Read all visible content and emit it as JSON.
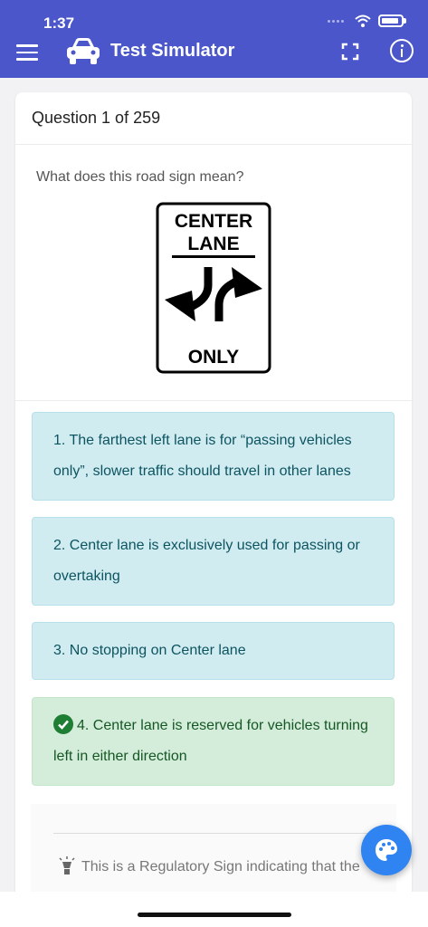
{
  "status_bar": {
    "time": "1:37"
  },
  "app_bar": {
    "title": "Test Simulator"
  },
  "question": {
    "counter": "Question 1 of 259",
    "text": "What does this road sign mean?",
    "sign": {
      "line1": "CENTER",
      "line2": "LANE",
      "line3": "ONLY"
    }
  },
  "answers": [
    {
      "label": "1. The farthest left lane is for “passing vehicles only”, slower traffic should travel in other lanes",
      "state": "info"
    },
    {
      "label": "2. Center lane is exclusively used for passing or overtaking",
      "state": "info"
    },
    {
      "label": "3. No stopping on Center lane",
      "state": "info"
    },
    {
      "label": "4. Center lane is reserved for vehicles turning left in either direction",
      "state": "correct"
    }
  ],
  "explanation": "This is a Regulatory Sign indicating that the",
  "icons": {
    "menu": "hamburger-menu-icon",
    "app": "car-icon",
    "fullscreen": "fullscreen-icon",
    "info": "info-icon",
    "check": "check-circle-icon",
    "bulb": "lightbulb-icon",
    "palette": "palette-icon"
  },
  "colors": {
    "primary": "#4a56c9",
    "answer_info_bg": "#d1ecf1",
    "answer_correct_bg": "#d4edda",
    "fab": "#2f84f2"
  }
}
